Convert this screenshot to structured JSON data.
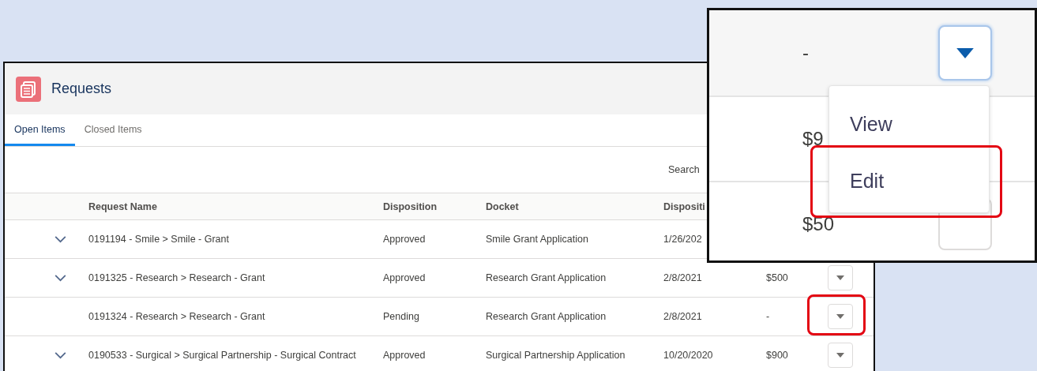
{
  "panel": {
    "title": "Requests",
    "tabs": [
      {
        "label": "Open Items",
        "selected": true
      },
      {
        "label": "Closed Items",
        "selected": false
      }
    ],
    "search": {
      "label": "Search"
    },
    "table": {
      "columns": [
        "Request Name",
        "Disposition",
        "Docket",
        "Dispositi"
      ],
      "rows": [
        {
          "expandable": true,
          "name": "0191194 - Smile > Smile - Grant",
          "disposition": "Approved",
          "docket": "Smile Grant Application",
          "date": "1/26/202",
          "action_button": false,
          "highlighted": false
        },
        {
          "expandable": true,
          "name": "0191325 - Research > Research - Grant",
          "disposition": "Approved",
          "docket": "Research Grant Application",
          "date": "2/8/2021",
          "amount": "$500",
          "action_button": true,
          "highlighted": false
        },
        {
          "expandable": false,
          "name": "0191324 - Research > Research - Grant",
          "disposition": "Pending",
          "docket": "Research Grant Application",
          "date": "2/8/2021",
          "amount": "-",
          "action_button": true,
          "highlighted": true
        },
        {
          "expandable": true,
          "name": "0190533 - Surgical > Surgical Partnership - Surgical Contract",
          "disposition": "Approved",
          "docket": "Surgical Partnership Application",
          "date": "10/20/2020",
          "amount": "$900",
          "action_button": true,
          "highlighted": false
        }
      ]
    }
  },
  "inset": {
    "rows": [
      {
        "amount": "-",
        "button": true,
        "active": true
      },
      {
        "amount": "$9",
        "button": false
      },
      {
        "amount": "$50",
        "button": true,
        "active": false
      }
    ],
    "menu": [
      {
        "label": "View",
        "highlighted": false
      },
      {
        "label": "Edit",
        "highlighted": true
      }
    ]
  }
}
